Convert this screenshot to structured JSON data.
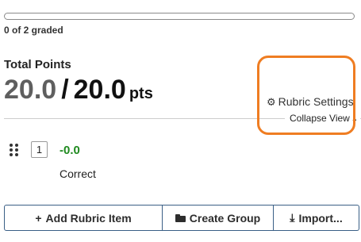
{
  "grading": {
    "graded_text": "0 of 2 graded",
    "graded_fraction": 0
  },
  "score": {
    "label": "Total Points",
    "earned": "20.0",
    "separator": "/",
    "max": "20.0",
    "unit": "pts"
  },
  "links": {
    "settings_icon": "gear-icon",
    "settings_label": "Rubric Settings",
    "collapse_label": "Collapse View",
    "collapse_icon": "caret-up-icon"
  },
  "rubric_items": [
    {
      "number": "1",
      "points": "-0.0",
      "description": "Correct"
    }
  ],
  "actions": {
    "add_item_icon": "plus-icon",
    "add_item_label": "Add Rubric Item",
    "create_group_icon": "folder-icon",
    "create_group_label": "Create Group",
    "import_icon": "download-icon",
    "import_label": "Import..."
  },
  "colors": {
    "highlight": "#ef7d22",
    "positive_points": "#1f8a1f",
    "button_border": "#3a5f86"
  }
}
